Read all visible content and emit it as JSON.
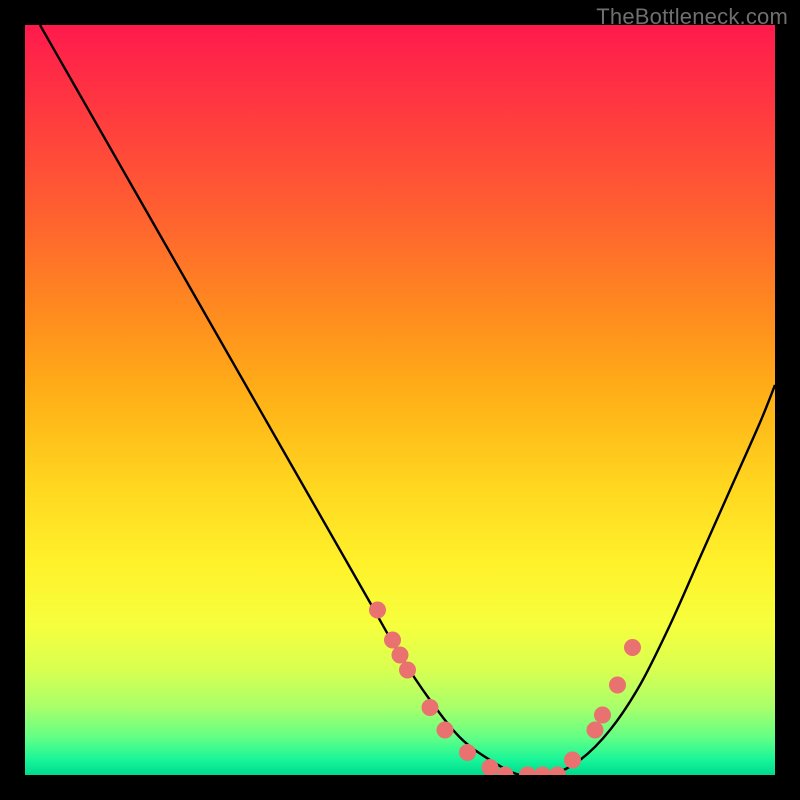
{
  "watermark": "TheBottleneck.com",
  "chart_data": {
    "type": "line",
    "title": "",
    "xlabel": "",
    "ylabel": "",
    "xlim": [
      0,
      100
    ],
    "ylim": [
      0,
      100
    ],
    "series": [
      {
        "name": "bottleneck-curve",
        "x": [
          2,
          6,
          10,
          14,
          18,
          22,
          26,
          30,
          34,
          38,
          42,
          46,
          50,
          54,
          58,
          62,
          66,
          70,
          74,
          78,
          82,
          86,
          90,
          94,
          98,
          100
        ],
        "y": [
          100,
          93,
          86,
          79,
          72,
          65,
          58,
          51,
          44,
          37,
          30,
          23,
          16,
          10,
          5,
          2,
          0,
          0,
          2,
          6,
          12,
          20,
          29,
          38,
          47,
          52
        ]
      }
    ],
    "markers": {
      "name": "highlight-points",
      "x": [
        47,
        49,
        50,
        51,
        54,
        56,
        59,
        62,
        64,
        67,
        69,
        71,
        73,
        76,
        77,
        79,
        81
      ],
      "y": [
        22,
        18,
        16,
        14,
        9,
        6,
        3,
        1,
        0,
        0,
        0,
        0,
        2,
        6,
        8,
        12,
        17
      ]
    },
    "background_gradient": {
      "top": "#ff1a4d",
      "mid": "#ffd820",
      "bottom": "#00d98f"
    }
  }
}
